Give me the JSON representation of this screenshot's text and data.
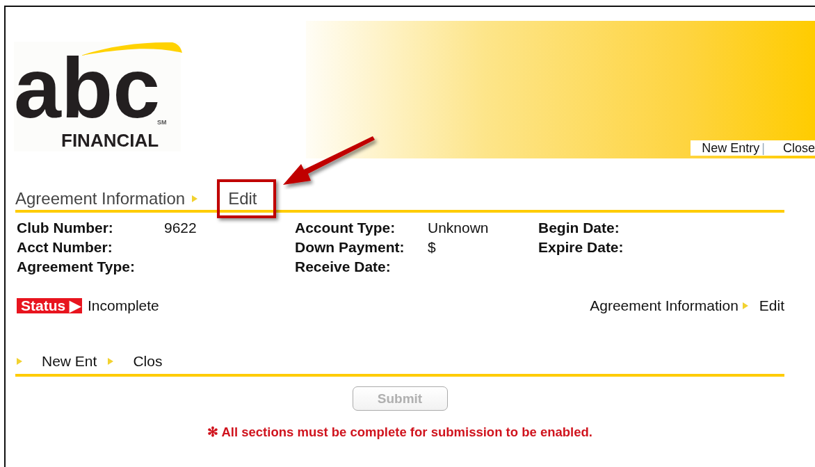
{
  "logo": {
    "wordmark": "abc",
    "trademark": "SM",
    "subtitle": "FINANCIAL"
  },
  "header_links": [
    {
      "label": "New Entry",
      "separator": "|"
    },
    {
      "label": "Close"
    }
  ],
  "section": {
    "title": "Agreement Information",
    "action": "Edit"
  },
  "fields": [
    [
      {
        "label": "Club Number:",
        "value": "9622"
      },
      {
        "label": "Acct Number:"
      },
      {
        "label": "Agreement Type:"
      }
    ],
    [
      {
        "label": "Account Type:",
        "value": "Unknown"
      },
      {
        "label": "Down Payment:",
        "value": "$"
      },
      {
        "label": "Receive Date:"
      }
    ],
    [
      {
        "label": "Begin Date:"
      },
      {
        "label": "Expire Date:"
      }
    ]
  ],
  "status": {
    "label": "Status",
    "icon": "▶",
    "value": "Incomplete"
  },
  "breadcrumb": {
    "title": "Agreement Information",
    "action": "Edit"
  },
  "bottom_links": [
    {
      "label": "New Ent"
    },
    {
      "label": "Clos"
    }
  ],
  "submit": {
    "label": "Submit",
    "disabled": true
  },
  "note": {
    "mark": "✻",
    "text": "All sections must be complete for submission to be enabled."
  }
}
